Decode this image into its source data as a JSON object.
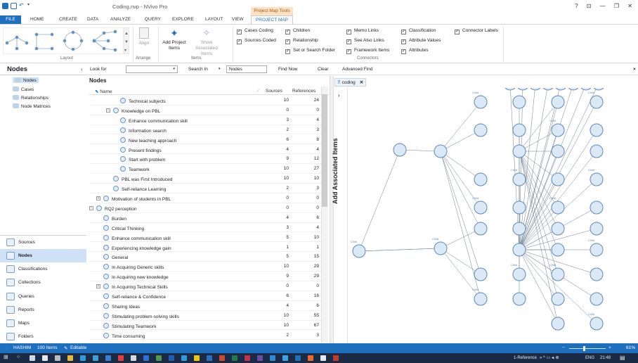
{
  "window": {
    "title": "Coding.nvp - NVivo Pro",
    "context_tab_group": "Project Map Tools",
    "controls": "? ⊡ — ❐ ✕"
  },
  "tabs": [
    "FILE",
    "HOME",
    "CREATE",
    "DATA",
    "ANALYZE",
    "QUERY",
    "EXPLORE",
    "LAYOUT",
    "VIEW",
    "PROJECT MAP"
  ],
  "ribbon": {
    "layout_label": "Layout",
    "arrange": {
      "align": "Align",
      "label": "Arrange"
    },
    "items": {
      "add": "Add Project Items",
      "show_associated": "Show Associated Items",
      "label": "Items"
    },
    "checks_col1": [
      {
        "label": "Cases Coding",
        "checked": true
      },
      {
        "label": "Sources Coded",
        "checked": true
      }
    ],
    "checks_col2": [
      {
        "label": "Children",
        "checked": true
      },
      {
        "label": "Relationship",
        "checked": true
      },
      {
        "label": "Set or Search Folder",
        "checked": true
      }
    ],
    "checks_col3": [
      {
        "label": "Memo Links",
        "checked": true
      },
      {
        "label": "See Also Links",
        "checked": true
      },
      {
        "label": "Framework Items",
        "checked": true
      }
    ],
    "checks_col4": [
      {
        "label": "Classification",
        "checked": true
      },
      {
        "label": "Attribute Values",
        "checked": true
      },
      {
        "label": "Attributes",
        "checked": true
      }
    ],
    "checks_col5": [
      {
        "label": "Connector Labels",
        "checked": true
      }
    ],
    "connectors_label": "Connectors"
  },
  "left_pane": {
    "title": "Nodes",
    "tree": [
      "Nodes",
      "Cases",
      "Relationships",
      "Node Matrices"
    ],
    "nav": [
      "Sources",
      "Nodes",
      "Classifications",
      "Collections",
      "Queries",
      "Reports",
      "Maps",
      "Folders"
    ],
    "nav_selected": "Nodes"
  },
  "findbar": {
    "look_for": "Look for",
    "search_in": "Search In",
    "scope": "Nodes",
    "find_now": "Find Now",
    "clear": "Clear",
    "advanced": "Advanced Find"
  },
  "list": {
    "title": "Nodes",
    "columns": [
      "Name",
      "Sources",
      "References"
    ],
    "rows": [
      {
        "name": "Technical subjects",
        "sources": "10",
        "refs": "24",
        "level": 3,
        "expander": ""
      },
      {
        "name": "Knowledge on PBL",
        "sources": "0",
        "refs": "0",
        "level": 2,
        "expander": "−"
      },
      {
        "name": "Enhance communication skill",
        "sources": "3",
        "refs": "4",
        "level": 3,
        "expander": ""
      },
      {
        "name": "Information search",
        "sources": "2",
        "refs": "3",
        "level": 3,
        "expander": ""
      },
      {
        "name": "New teaching approach",
        "sources": "6",
        "refs": "8",
        "level": 3,
        "expander": ""
      },
      {
        "name": "Present findings",
        "sources": "4",
        "refs": "4",
        "level": 3,
        "expander": ""
      },
      {
        "name": "Start with problem",
        "sources": "9",
        "refs": "12",
        "level": 3,
        "expander": ""
      },
      {
        "name": "Teamwork",
        "sources": "10",
        "refs": "27",
        "level": 3,
        "expander": ""
      },
      {
        "name": "PBL was First Introduced",
        "sources": "10",
        "refs": "10",
        "level": 2,
        "expander": ""
      },
      {
        "name": "Self-reliance Learning",
        "sources": "2",
        "refs": "3",
        "level": 2,
        "expander": ""
      },
      {
        "name": "Motivation of students in PBL",
        "sources": "0",
        "refs": "0",
        "level": 1,
        "expander": "+"
      },
      {
        "name": "RQ2 perception",
        "sources": "0",
        "refs": "0",
        "level": 0,
        "expander": "−"
      },
      {
        "name": "Burden",
        "sources": "4",
        "refs": "6",
        "level": 1,
        "expander": ""
      },
      {
        "name": "Critical Thinking",
        "sources": "3",
        "refs": "4",
        "level": 1,
        "expander": ""
      },
      {
        "name": "Enhance communication skill",
        "sources": "5",
        "refs": "10",
        "level": 1,
        "expander": ""
      },
      {
        "name": "Experiencing knowledge gain",
        "sources": "1",
        "refs": "1",
        "level": 1,
        "expander": ""
      },
      {
        "name": "General",
        "sources": "5",
        "refs": "15",
        "level": 1,
        "expander": ""
      },
      {
        "name": "In Acquiring Generic skills",
        "sources": "10",
        "refs": "29",
        "level": 1,
        "expander": ""
      },
      {
        "name": "In Acquiring new knowledge",
        "sources": "9",
        "refs": "29",
        "level": 1,
        "expander": ""
      },
      {
        "name": "In Acquiring Technical Skills",
        "sources": "0",
        "refs": "0",
        "level": 1,
        "expander": "+"
      },
      {
        "name": "Self-reliance & Confidence",
        "sources": "6",
        "refs": "16",
        "level": 1,
        "expander": ""
      },
      {
        "name": "Sharing Ideas",
        "sources": "4",
        "refs": "6",
        "level": 1,
        "expander": ""
      },
      {
        "name": "Stimulating problem-solving skills",
        "sources": "10",
        "refs": "55",
        "level": 1,
        "expander": ""
      },
      {
        "name": "Stimulating Teamwork",
        "sources": "10",
        "refs": "67",
        "level": 1,
        "expander": ""
      },
      {
        "name": "Time consuming",
        "sources": "2",
        "refs": "3",
        "level": 1,
        "expander": ""
      }
    ]
  },
  "map": {
    "tab": "coding",
    "side_label": "Add Associated Items",
    "child_label": "Child"
  },
  "status": {
    "user": "HASHIM",
    "items": "100 Items",
    "mode": "Editable",
    "zoom": "61%"
  },
  "taskbar": {
    "ref": "1-Reference",
    "lang": "ENG",
    "time": "21:48"
  }
}
